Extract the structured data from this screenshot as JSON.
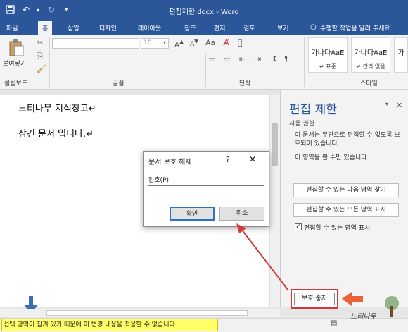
{
  "window": {
    "title": "편집제한.docx - Word"
  },
  "tabs": [
    {
      "label": "파일"
    },
    {
      "label": "홈"
    },
    {
      "label": "삽입"
    },
    {
      "label": "디자인"
    },
    {
      "label": "레이아웃"
    },
    {
      "label": "참조"
    },
    {
      "label": "편지"
    },
    {
      "label": "검토"
    },
    {
      "label": "보기"
    }
  ],
  "tell_me": "수행할 작업을 알려 주세요.",
  "ribbon": {
    "paste_label": "붙여넣기",
    "font_size": "10",
    "groups": {
      "clipboard": "클립보드",
      "font": "글꼴",
      "paragraph": "단락",
      "styles": "스타일"
    },
    "styles": [
      {
        "preview": "가나다AaE",
        "name": "↵ 표준"
      },
      {
        "preview": "가나다AaE",
        "name": "↵ 간격 없음"
      },
      {
        "preview": "가",
        "name": ""
      }
    ]
  },
  "document": {
    "lines": [
      "느티나무 지식창고↵",
      "잠긴 문서 입니다.↵"
    ]
  },
  "dialog": {
    "title": "문서 보호 해제",
    "help": "?",
    "close": "✕",
    "password_label": "암호(P):",
    "password_value": "",
    "ok_label": "확인",
    "cancel_label": "취소"
  },
  "pane": {
    "title": "편집 제한",
    "section": "사용 권한",
    "description": "이 문서는 무단으로 편집할 수 없도록 보호되어 있습니다.",
    "view_text": "이 영역을 볼 수만 있습니다.",
    "find_next_btn": "편집할 수 있는 다음 영역 찾기",
    "show_all_btn": "편집할 수 있는 모든 영역 표시",
    "highlight_label": "편집할 수 있는 영역 표시",
    "highlight_checked": true,
    "stop_protection_btn": "보호 중지"
  },
  "status": {
    "message": "선택 영역이 잠겨 있기 때문에 이 변경 내용을 적용할 수 없습니다."
  },
  "watermark": "느티나무",
  "colors": {
    "title_bar": "#2b579a",
    "highlight_red": "#d23a3a",
    "status_highlight": "#ffff66",
    "arrow_blue": "#3a6fb0",
    "arrow_orange": "#e8623a"
  }
}
